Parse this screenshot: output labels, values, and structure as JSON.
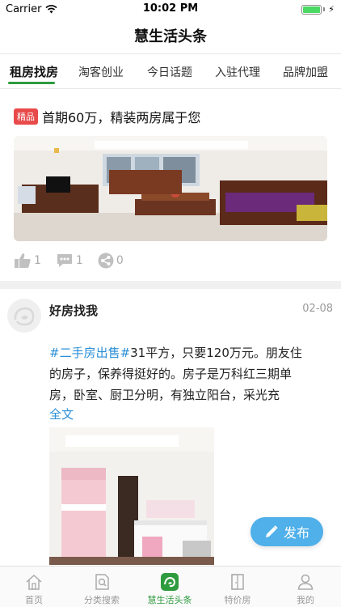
{
  "status": {
    "carrier": "Carrier",
    "time": "10:02 PM"
  },
  "nav": {
    "title": "慧生活头条"
  },
  "tabs": [
    {
      "label": "租房找房",
      "active": true
    },
    {
      "label": "淘客创业"
    },
    {
      "label": "今日话题"
    },
    {
      "label": "入驻代理"
    },
    {
      "label": "品牌加盟"
    }
  ],
  "card1": {
    "badge": "精品",
    "headline": "首期60万，精装两房属于您",
    "likes": "1",
    "comments": "1",
    "shares": "0"
  },
  "post": {
    "author": "好房找我",
    "date": "02-08",
    "tag": "#二手房出售#",
    "text_line1": "31平方，只要120万元。朋友住",
    "text_line2": "的房子，保养得挺好的。房子是万科红三期单",
    "text_line3": "房，卧室、厨卫分明，有独立阳台，采光充",
    "fulltext": "全文"
  },
  "publish": {
    "label": "发布"
  },
  "tabbar": [
    {
      "label": "首页",
      "icon": "home-icon"
    },
    {
      "label": "分类搜索",
      "icon": "search-doc-icon"
    },
    {
      "label": "慧生活头条",
      "icon": "news-icon",
      "active": true
    },
    {
      "label": "特价房",
      "icon": "door-icon"
    },
    {
      "label": "我的",
      "icon": "person-icon"
    }
  ],
  "colors": {
    "accent": "#2e9b3e",
    "link": "#2b8fd6",
    "badge": "#e84a4a",
    "publish": "#4fb0ea"
  }
}
